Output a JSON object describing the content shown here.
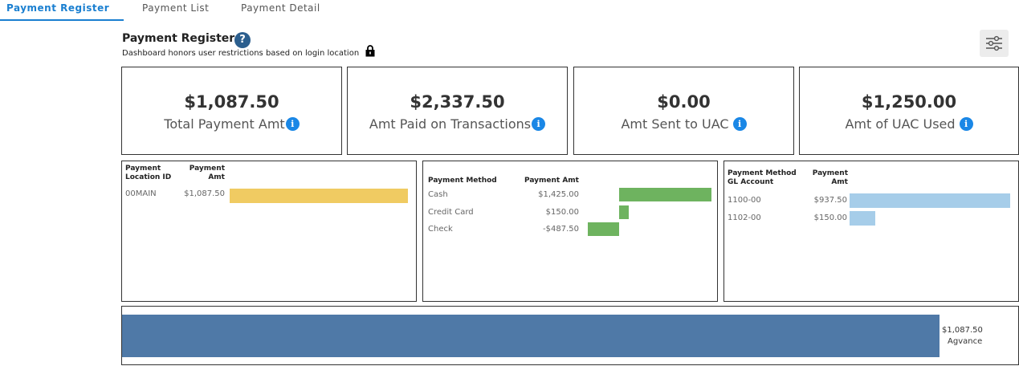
{
  "tabs": [
    {
      "label": "Payment Register",
      "active": true
    },
    {
      "label": "Payment List",
      "active": false
    },
    {
      "label": "Payment Detail",
      "active": false
    }
  ],
  "header": {
    "title": "Payment Register",
    "help_icon": "?",
    "subtitle": "Dashboard honors user restrictions based on login location"
  },
  "kpis": [
    {
      "value": "$1,087.50",
      "label": "Total Payment Amt",
      "info": "i"
    },
    {
      "value": "$2,337.50",
      "label": "Amt Paid on Transactions",
      "info": "i"
    },
    {
      "value": "$0.00",
      "label": "Amt Sent to UAC",
      "info": "i"
    },
    {
      "value": "$1,250.00",
      "label": "Amt of UAC Used",
      "info": "i"
    }
  ],
  "panel1": {
    "col1": "Payment\nLocation ID",
    "col2": "Payment\nAmt",
    "rows": [
      {
        "id": "00MAIN",
        "amt": "$1,087.50",
        "value": 1087.5
      }
    ],
    "color": "#f0cb62"
  },
  "panel2": {
    "col1": "Payment Method",
    "col2": "Payment Amt",
    "rows": [
      {
        "method": "Cash",
        "amt": "$1,425.00",
        "value": 1425.0
      },
      {
        "method": "Credit Card",
        "amt": "$150.00",
        "value": 150.0
      },
      {
        "method": "Check",
        "amt": "-$487.50",
        "value": -487.5
      }
    ],
    "color": "#6eb35f"
  },
  "panel3": {
    "col1": "Payment Method\nGL Account",
    "col2": "Payment\nAmt",
    "rows": [
      {
        "account": "1100-00",
        "amt": "$937.50",
        "value": 937.5
      },
      {
        "account": "1102-00",
        "amt": "$150.00",
        "value": 150.0
      }
    ],
    "color": "#a6cde9"
  },
  "bottom": {
    "value": 1087.5,
    "value_label": "$1,087.50",
    "label": "Agvance",
    "color": "#4f79a7"
  },
  "icons": {
    "help": "question-circle-icon",
    "lock": "lock-icon",
    "filter": "sliders-icon",
    "info": "info-circle-icon"
  }
}
